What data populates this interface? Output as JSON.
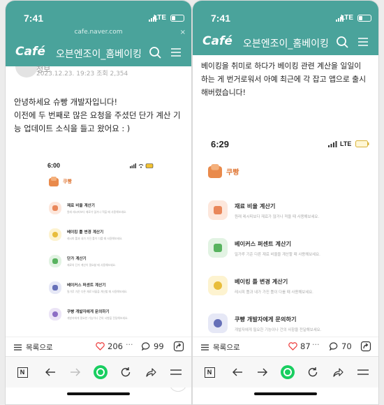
{
  "left": {
    "status": {
      "time": "7:41",
      "network": "LTE"
    },
    "url": "cafe.naver.com",
    "header": {
      "logo": "Café",
      "cafe_name": "오븐엔조이_홈베이킹"
    },
    "post": {
      "author_name": "정보",
      "date": "2023.12.23. 19:23",
      "views": "조회 2,354",
      "body": "안녕하세요 슈빵 개발자입니다!\n이전에 두 번째로 많은 요청을 주셨던 단가 계산 기능 업데이트 소식을 들고 왔어요 : )"
    },
    "inner": {
      "time": "6:00",
      "brand": "쿠빵",
      "features": [
        {
          "title": "재료 비율 계산기",
          "desc": "원래 레시피보다 재료가 많거나 적을 때 사용해보세요.",
          "icon": "calculator-icon",
          "color": "#fde7dc",
          "fg": "#e9875a"
        },
        {
          "title": "베이킹 틀 변경 계산기",
          "desc": "레시피 틀과 내가 가진 틀이 다를 때 사용해보세요.",
          "icon": "pan-icon",
          "color": "#fdf3d0",
          "fg": "#e8bd3c"
        },
        {
          "title": "단가 계산기",
          "desc": "재료의 단가 계산이 필요할 때 사용해보세요.",
          "icon": "price-icon",
          "color": "#e2f3e3",
          "fg": "#58b35f"
        },
        {
          "title": "베이커스 퍼센트 계산기",
          "desc": "밀가루 기준 다른 재료 비율을 계산할 때 사용해보세요.",
          "icon": "percent-icon",
          "color": "#e6e8f6",
          "fg": "#6670b8"
        },
        {
          "title": "쿠빵 개발자에게 문의하기",
          "desc": "개발자에게 필요한 기능이나 건의 사항을 전달해보세요.",
          "icon": "chat-icon",
          "color": "#ebe4f6",
          "fg": "#8c6dc5"
        }
      ]
    },
    "actions": {
      "list_label": "목록으로",
      "likes": "206",
      "dots": "···",
      "comments": "99"
    }
  },
  "right": {
    "status": {
      "time": "7:41",
      "network": "LTE"
    },
    "header": {
      "logo": "Café",
      "cafe_name": "오븐엔조이_홈베이킹"
    },
    "post": {
      "body": "베이킹을 취미로 하다가 베이킹 관련 계산을 일일이 하는 게 번거로워서 아예 최근에 각 잡고 앱으로 출시해버렸습니다!"
    },
    "inner": {
      "time": "6:29",
      "network": "LTE",
      "brand": "쿠빵",
      "features": [
        {
          "title": "재료 비율 계산기",
          "desc": "원래 레시피보다 재료가 많거나 적을 때 사용해보세요.",
          "icon": "calculator-icon",
          "color": "#fde7dc",
          "fg": "#e9875a"
        },
        {
          "title": "베이커스 퍼센트 계산기",
          "desc": "밀가루 기준 다른 재료 비율을 계산할 때 사용해보세요.",
          "icon": "percent-icon",
          "color": "#e2f3e3",
          "fg": "#58b35f"
        },
        {
          "title": "베이킹 틀 변경 계산기",
          "desc": "레시피 틀과 내가 가진 틀이 다를 때 사용해보세요.",
          "icon": "pan-icon",
          "color": "#fdf3d0",
          "fg": "#e8bd3c"
        },
        {
          "title": "쿠빵 개발자에게 문의하기",
          "desc": "개발자에게 필요한 기능이나 건의 사항을 전달해보세요.",
          "icon": "chat-icon",
          "color": "#e6e8f6",
          "fg": "#6670b8"
        }
      ]
    },
    "actions": {
      "list_label": "목록으로",
      "likes": "87",
      "dots": "···",
      "comments": "70"
    }
  },
  "nav": {
    "n_label": "N"
  },
  "colors": {
    "brand_teal": "#4aa39b",
    "like_red": "#e44",
    "naver_green": "#19ce60"
  }
}
